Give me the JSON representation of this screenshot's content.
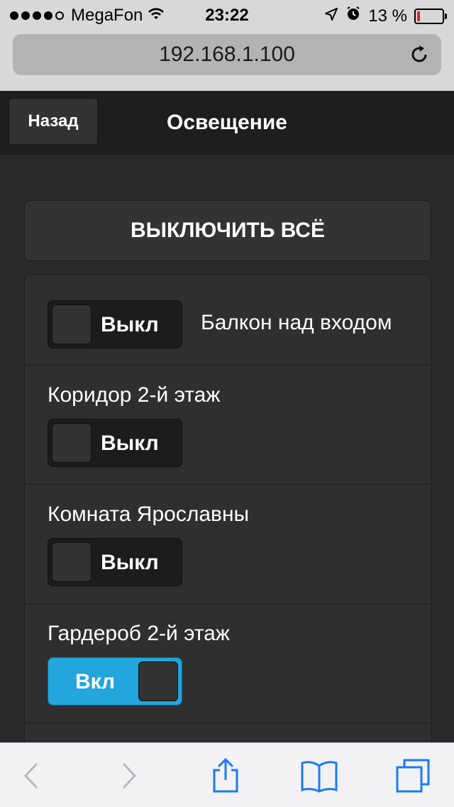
{
  "statusbar": {
    "carrier": "MegaFon",
    "time": "23:22",
    "battery_percent": "13 %",
    "battery_level": 0.13,
    "signal_bars": 4
  },
  "browser": {
    "url": "192.168.1.100"
  },
  "header": {
    "back_label": "Назад",
    "title": "Освещение"
  },
  "main": {
    "all_off_label": "ВЫКЛЮЧИТЬ ВСЁ",
    "items": [
      {
        "label": "Балкон над входом",
        "state": "Выкл",
        "on": false
      },
      {
        "label": "Коридор 2-й этаж",
        "state": "Выкл",
        "on": false
      },
      {
        "label": "Комната Ярославны",
        "state": "Выкл",
        "on": false
      },
      {
        "label": "Гардероб 2-й этаж",
        "state": "Вкл",
        "on": true
      }
    ]
  },
  "toolbar": {
    "icons": [
      "back-icon",
      "forward-icon",
      "share-icon",
      "bookmarks-icon",
      "tabs-icon"
    ]
  },
  "colors": {
    "accent_on": "#22a6dc",
    "battery_low": "#e0242a",
    "toolbar_icon": "#1a7cf5"
  }
}
